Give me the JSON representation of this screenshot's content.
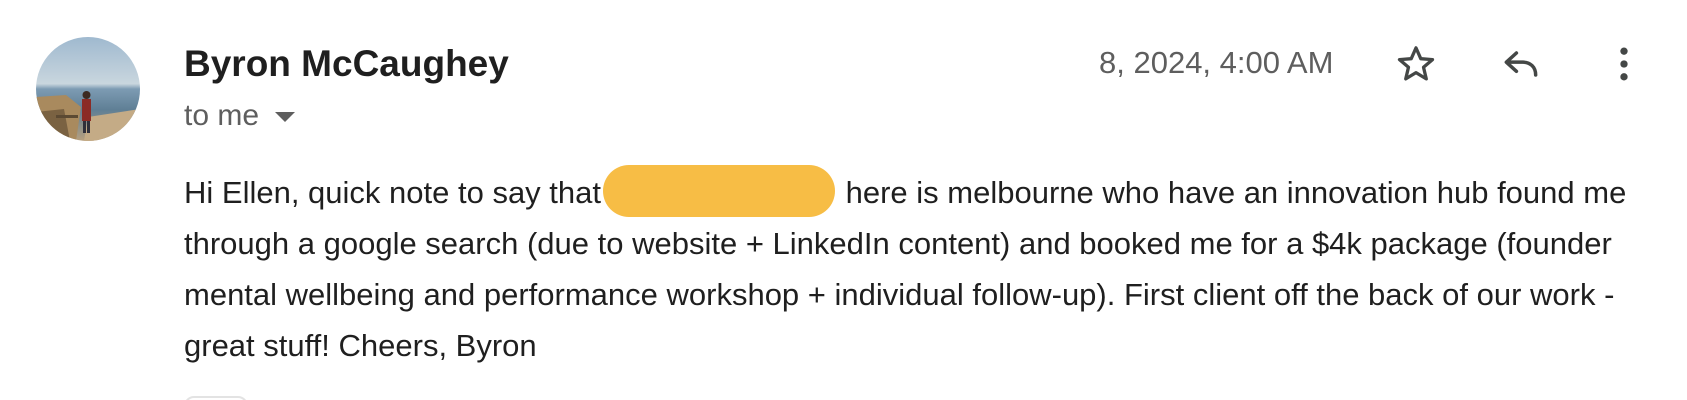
{
  "email": {
    "sender_name": "Byron McCaughey",
    "recipient_label": "to me",
    "timestamp": "8, 2024, 4:00 AM",
    "body": {
      "before_redaction": "Hi Ellen, quick note to say that",
      "after_redaction": " here is melbourne who have an innovation hub found me through a google search (due to website + LinkedIn content) and booked me for a $4k package (founder mental wellbeing and performance workshop + individual follow-up). First client off the back of our work - great stuff! Cheers, Byron"
    }
  },
  "icons": {
    "star": "star-icon",
    "reply": "reply-icon",
    "more": "more-vert-icon",
    "dropdown": "caret-down-icon"
  },
  "colors": {
    "redaction": "#f7bd45",
    "text_primary": "#1f1f1f",
    "text_secondary": "#5e5e5e"
  }
}
